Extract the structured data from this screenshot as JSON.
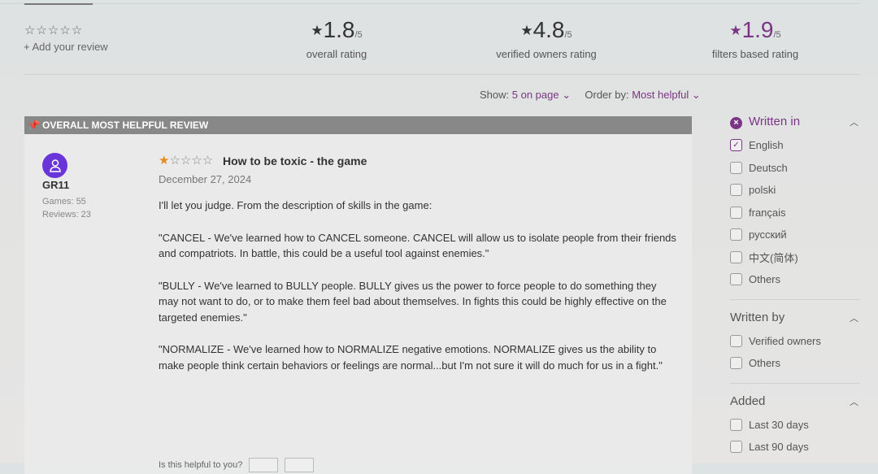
{
  "user_rating": {
    "stars": "☆☆☆☆☆",
    "add_review": "+ Add your review"
  },
  "ratings": [
    {
      "star": "★",
      "value": "1.8",
      "of": "/5",
      "label": "overall rating"
    },
    {
      "star": "★",
      "value": "4.8",
      "of": "/5",
      "label": "verified owners rating"
    },
    {
      "star": "★",
      "value": "1.9",
      "of": "/5",
      "label": "filters based rating"
    }
  ],
  "sort": {
    "show_label": "Show:",
    "show_value": "5 on page",
    "order_label": "Order by:",
    "order_value": "Most helpful",
    "chevron": "⌄"
  },
  "review": {
    "header": "OVERALL MOST HELPFUL REVIEW",
    "user": "GR11",
    "games": "Games: 55",
    "reviews": "Reviews: 23",
    "rating": 1,
    "stars_on": "★",
    "stars_off": "☆☆☆☆",
    "title": "How to be toxic - the game",
    "date": "December 27, 2024",
    "paragraphs": [
      "I'll let you judge. From the description of skills in the game:",
      "\"CANCEL - We've learned how to CANCEL someone. CANCEL will allow us to isolate people from their friends and compatriots. In battle, this could be a useful tool against enemies.\"",
      "\"BULLY - We've learned to BULLY people. BULLY gives us the power to force people to do something they may not want to do, or to make them feel bad about themselves. In fights this could be highly effective on the targeted enemies.\"",
      "\"NORMALIZE - We've learned how to NORMALIZE negative emotions. NORMALIZE gives us the ability to make people think certain behaviors or feelings are normal...but I'm not sure it will do much for us in a fight.\""
    ],
    "helpful_label": "Is this helpful to you?"
  },
  "filters": {
    "written_in": {
      "title": "Written in",
      "options": [
        {
          "label": "English",
          "checked": true
        },
        {
          "label": "Deutsch",
          "checked": false
        },
        {
          "label": "polski",
          "checked": false
        },
        {
          "label": "français",
          "checked": false
        },
        {
          "label": "русский",
          "checked": false
        },
        {
          "label": "中文(简体)",
          "checked": false
        },
        {
          "label": "Others",
          "checked": false
        }
      ]
    },
    "written_by": {
      "title": "Written by",
      "options": [
        {
          "label": "Verified owners",
          "checked": false
        },
        {
          "label": "Others",
          "checked": false
        }
      ]
    },
    "added": {
      "title": "Added",
      "options": [
        {
          "label": "Last 30 days",
          "checked": false
        },
        {
          "label": "Last 90 days",
          "checked": false
        }
      ]
    }
  },
  "colors": {
    "accent": "#7b3585",
    "avatar": "#6a35d8",
    "star": "#e68a1a"
  }
}
